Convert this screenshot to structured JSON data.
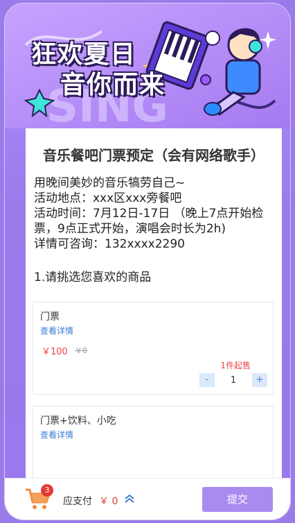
{
  "banner": {
    "title_line1": "狂欢夏日",
    "title_line2": "音你而来",
    "bg_text": "SING"
  },
  "event": {
    "title": "音乐餐吧门票预定（会有网络歌手）",
    "desc_lines": [
      "用晚间美妙的音乐犒劳自己~",
      "活动地点：xxx区xxx旁餐吧",
      "活动时间：7月12日-17日 （晚上7点开始检票，9点正式开始，演唱会时长为2h)",
      "详情可咨询：132xxxx2290"
    ],
    "section_prompt": "1.请挑选您喜欢的商品"
  },
  "products": [
    {
      "name": "门票",
      "detail_link": "查看详情",
      "price": "￥100",
      "original_price": "￥0",
      "min_purchase": "1件起售",
      "quantity": "1",
      "minus": "-",
      "plus": "+"
    },
    {
      "name": "门票+饮料、小吃",
      "detail_link": "查看详情"
    }
  ],
  "footer": {
    "cart_count": "3",
    "pay_label": "应支付",
    "pay_amount": "￥ 0",
    "submit_label": "提交"
  },
  "colors": {
    "accent": "#a98bf0",
    "price": "#e44",
    "link": "#3a7bd5"
  },
  "icons": [
    "cart-icon",
    "chevron-up-icon"
  ]
}
